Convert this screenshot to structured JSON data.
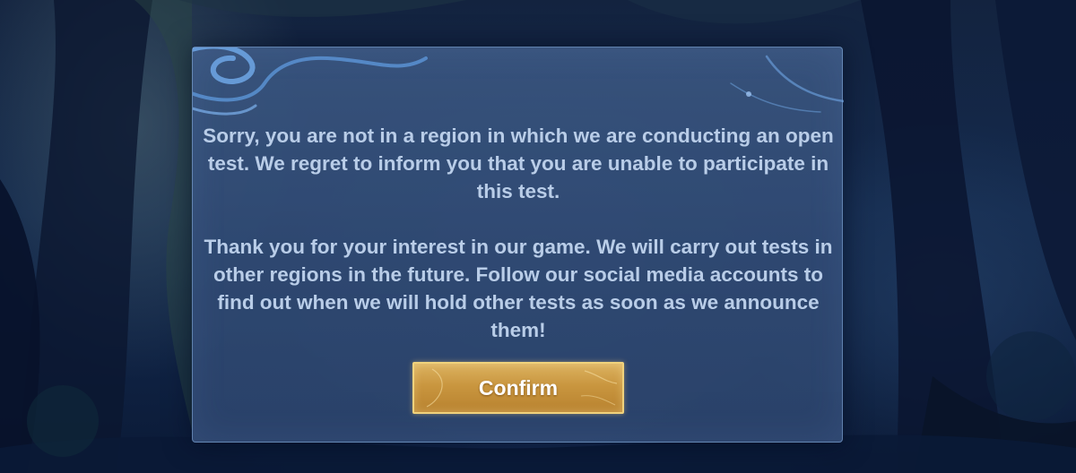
{
  "dialog": {
    "message_paragraphs": [
      "Sorry, you are not in a region in which we are conducting an open test. We regret to inform you that you are unable to participate in this test.",
      "Thank you for your interest in our game. We will carry out tests in other regions in the future. Follow our social media accounts to find out when we will hold other tests as soon as we announce them!"
    ],
    "confirm_label": "Confirm"
  },
  "colors": {
    "panel": "#3a5680",
    "text": "#b9cde8",
    "button_gold": "#c9963f",
    "button_border": "#f0d27c"
  }
}
